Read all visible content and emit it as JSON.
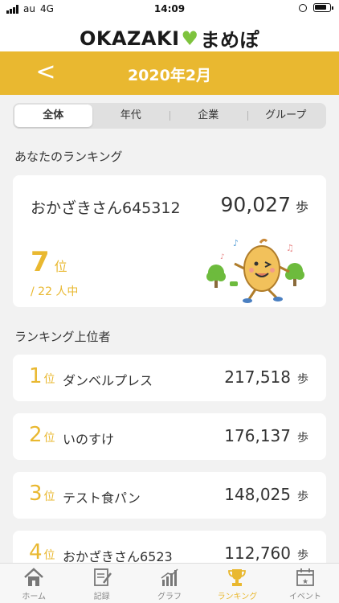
{
  "status": {
    "carrier": "au",
    "network": "4G",
    "time": "14:09"
  },
  "app": {
    "logo_left": "OKAZAKI",
    "logo_right": "まめぽ"
  },
  "header": {
    "back_label": "<",
    "title": "2020年2月"
  },
  "tabs": [
    {
      "label": "全体",
      "active": true
    },
    {
      "label": "年代",
      "active": false
    },
    {
      "label": "企業",
      "active": false
    },
    {
      "label": "グループ",
      "active": false
    }
  ],
  "my_ranking": {
    "section_title": "あなたのランキング",
    "name": "おかざきさん645312",
    "steps": "90,027",
    "steps_unit": "歩",
    "rank": "7",
    "rank_unit": "位",
    "total": "/ 22 人中"
  },
  "top_rankers": {
    "section_title": "ランキング上位者",
    "items": [
      {
        "rank": "1",
        "rank_unit": "位",
        "name": "ダンベルプレス",
        "steps": "217,518",
        "unit": "歩"
      },
      {
        "rank": "2",
        "rank_unit": "位",
        "name": "いのすけ",
        "steps": "176,137",
        "unit": "歩"
      },
      {
        "rank": "3",
        "rank_unit": "位",
        "name": "テスト食パン",
        "steps": "148,025",
        "unit": "歩"
      },
      {
        "rank": "4",
        "rank_unit": "位",
        "name": "おかざきさん6523",
        "steps": "112,760",
        "unit": "歩"
      }
    ]
  },
  "tabbar": [
    {
      "label": "ホーム",
      "icon": "home-icon",
      "active": false
    },
    {
      "label": "記録",
      "icon": "record-icon",
      "active": false
    },
    {
      "label": "グラフ",
      "icon": "graph-icon",
      "active": false
    },
    {
      "label": "ランキング",
      "icon": "trophy-icon",
      "active": true
    },
    {
      "label": "イベント",
      "icon": "calendar-icon",
      "active": false
    }
  ],
  "colors": {
    "accent": "#e9b830",
    "heart": "#7ec33d",
    "background": "#f2f2f2"
  }
}
